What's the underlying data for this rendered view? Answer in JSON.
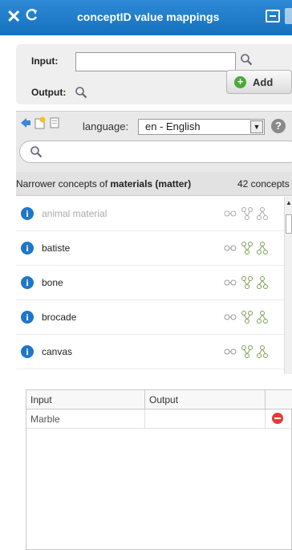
{
  "header": {
    "title": "conceptID value mappings",
    "close_glyph": "✕"
  },
  "mapper": {
    "input_label": "Input:",
    "input_value": "",
    "output_label": "Output:",
    "add_label": "Add"
  },
  "concepts": {
    "language_label": "language:",
    "language_value": "en - English",
    "search_value": "",
    "breadcrumb_prefix": "Narrower concepts of ",
    "breadcrumb_term": "materials (matter)",
    "count_label": "42 concepts",
    "items": [
      {
        "label": "animal material",
        "disabled": true
      },
      {
        "label": "batiste",
        "disabled": false
      },
      {
        "label": "bone",
        "disabled": false
      },
      {
        "label": "brocade",
        "disabled": false
      },
      {
        "label": "canvas",
        "disabled": false
      }
    ]
  },
  "mappings_table": {
    "columns": [
      "Input",
      "Output"
    ],
    "rows": [
      {
        "input": "Marble",
        "output": ""
      }
    ]
  },
  "colors": {
    "header": "#1f7cca",
    "info": "#1e76c8",
    "remove": "#e53a3a",
    "add": "#4aa93a"
  },
  "icons": [
    "close-icon",
    "refresh-icon",
    "expand-icon",
    "search-icon",
    "back-arrow-icon",
    "folder-icon",
    "page-icon",
    "help-icon",
    "info-icon",
    "link-icon",
    "hierarchy-icon",
    "tree-icon",
    "remove-icon",
    "add-icon"
  ]
}
